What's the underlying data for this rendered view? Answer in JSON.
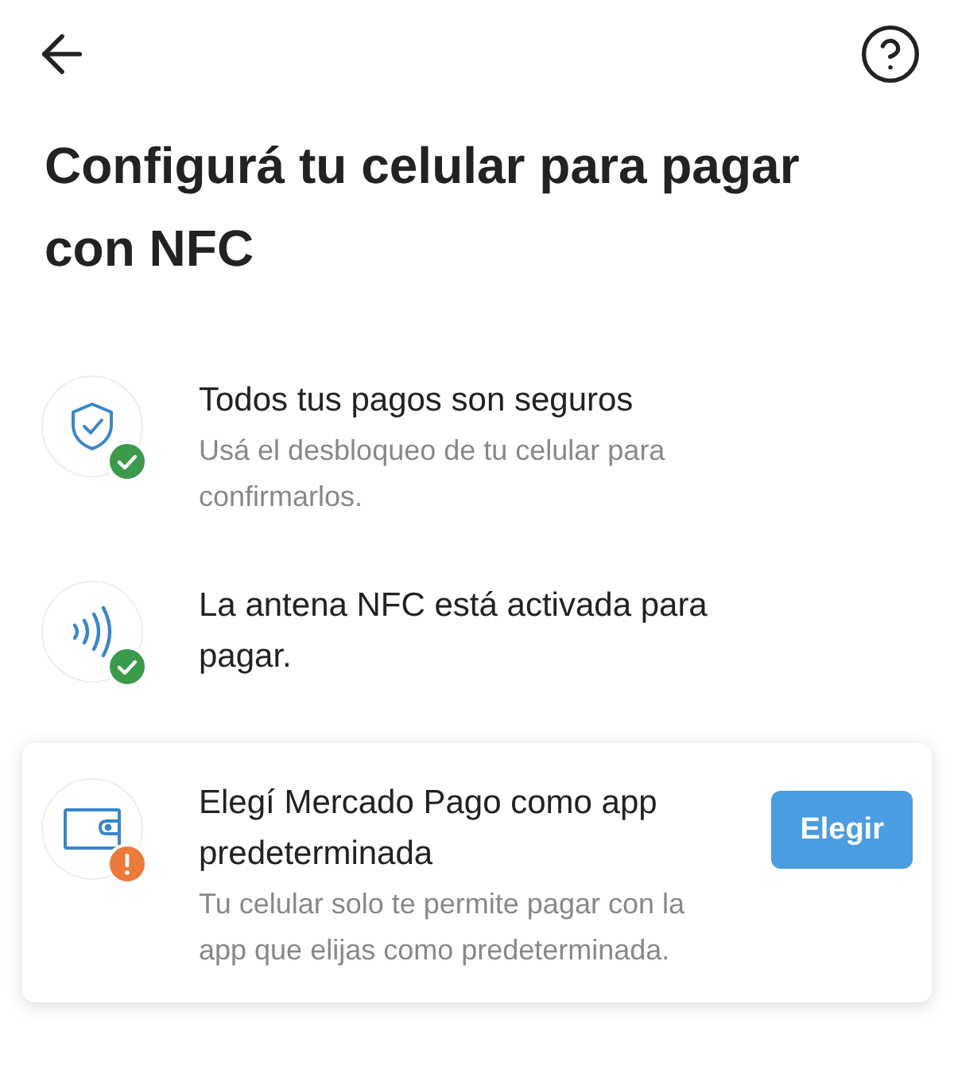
{
  "title": "Configurá tu celular para pagar con NFC",
  "steps": [
    {
      "kind": "shield",
      "done": true,
      "title": "Todos tus pagos son seguros",
      "description": "Usá el desbloqueo de tu celular para confirmarlos."
    },
    {
      "kind": "nfc",
      "done": true,
      "title": "La antena NFC está activada para pagar."
    },
    {
      "kind": "wallet",
      "done": false,
      "title": "Elegí Mercado Pago como app predeterminada",
      "description": "Tu celular solo te permite pagar con la app que elijas como predeterminada.",
      "button": "Elegir"
    }
  ]
}
